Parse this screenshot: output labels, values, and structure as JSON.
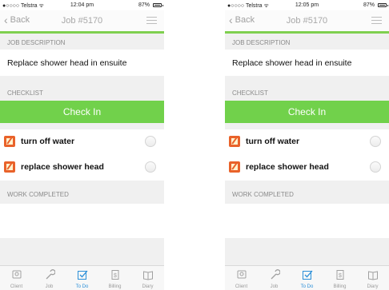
{
  "screens": [
    {
      "status": {
        "carrier": "●○○○○ Telstra ᯤ",
        "time": "12:04 pm",
        "battery": "87%"
      },
      "nav": {
        "back": "Back",
        "title": "Job #5170"
      },
      "job_description_header": "JOB DESCRIPTION",
      "description": "Replace shower head in ensuite",
      "checklist_header": "CHECKLIST",
      "checkin_label": "Check In",
      "tasks": [
        {
          "label": "turn off water"
        },
        {
          "label": "replace shower head"
        }
      ],
      "work_completed_header": "WORK COMPLETED",
      "tabs": [
        "Client",
        "Job",
        "To Do",
        "Billing",
        "Diary"
      ]
    },
    {
      "status": {
        "carrier": "●○○○○ Telstra ᯤ",
        "time": "12:05 pm",
        "battery": "87%"
      },
      "nav": {
        "back": "Back",
        "title": "Job #5170"
      },
      "job_description_header": "JOB DESCRIPTION",
      "description": "Replace shower head in ensuite",
      "checklist_header": "CHECKLIST",
      "checkin_label": "Check In",
      "tasks": [
        {
          "label": "turn off water"
        },
        {
          "label": "replace shower head"
        }
      ],
      "work_completed_header": "WORK COMPLETED",
      "tabs": [
        "Client",
        "Job",
        "To Do",
        "Billing",
        "Diary"
      ]
    }
  ],
  "active_tab": "To Do",
  "colors": {
    "accent_green": "#71d14b",
    "active_tab_blue": "#2a8fd8",
    "task_icon_orange": "#e9622a"
  },
  "tab_icons": [
    "client-icon",
    "wrench-icon",
    "todo-check-icon",
    "billing-icon",
    "diary-icon"
  ]
}
